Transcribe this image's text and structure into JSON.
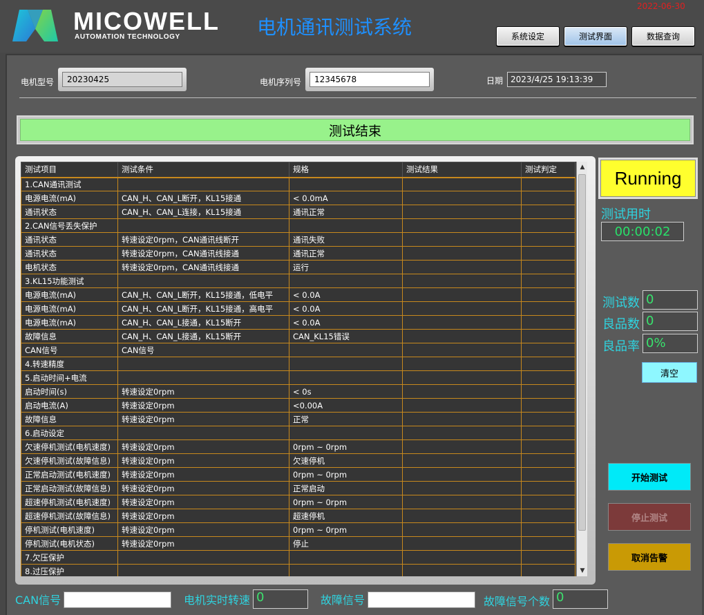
{
  "header": {
    "logo_text": "MICOWELL",
    "logo_sub": "AUTOMATION TECHNOLOGY",
    "title": "电机通讯测试系统",
    "corner_date": "2022-06-30",
    "nav": [
      "系统设定",
      "测试界面",
      "数据查询"
    ],
    "active_nav": 1
  },
  "info": {
    "model_label": "电机型号",
    "model_value": "20230425",
    "serial_label": "电机序列号",
    "serial_value": "12345678",
    "date_label": "日期",
    "date_value": "2023/4/25 19:13:39"
  },
  "status_text": "测试结束",
  "table": {
    "headers": [
      "测试项目",
      "测试条件",
      "规格",
      "测试结果",
      "测试判定"
    ],
    "rows": [
      [
        "1.CAN通讯测试",
        "",
        "",
        "",
        ""
      ],
      [
        "电源电流(mA)",
        "CAN_H、CAN_L断开，KL15接通",
        " < 0.0mA",
        "",
        ""
      ],
      [
        "通讯状态",
        "CAN_H、CAN_L连接，KL15接通",
        "通讯正常",
        "",
        ""
      ],
      [
        "2.CAN信号丢失保护",
        "",
        "",
        "",
        ""
      ],
      [
        "通讯状态",
        "转速设定0rpm，CAN通讯线断开",
        "通讯失败",
        "",
        ""
      ],
      [
        "通讯状态",
        "转速设定0rpm，CAN通讯线接通",
        "通讯正常",
        "",
        ""
      ],
      [
        "电机状态",
        "转速设定0rpm，CAN通讯线接通",
        "运行",
        "",
        ""
      ],
      [
        "3.KL15功能测试",
        "",
        "",
        "",
        ""
      ],
      [
        "电源电流(mA)",
        "CAN_H、CAN_L断开，KL15接通，低电平",
        " < 0.0A",
        "",
        ""
      ],
      [
        "电源电流(mA)",
        "CAN_H、CAN_L断开，KL15接通，高电平",
        " < 0.0A",
        "",
        ""
      ],
      [
        "电源电流(mA)",
        "CAN_H、CAN_L接通，KL15断开",
        " < 0.0A",
        "",
        ""
      ],
      [
        "故障信息",
        "CAN_H、CAN_L接通，KL15断开",
        "CAN_KL15错误",
        "",
        ""
      ],
      [
        "CAN信号",
        "CAN信号",
        "",
        "",
        ""
      ],
      [
        "4.转速精度",
        "",
        "",
        "",
        ""
      ],
      [
        "5.启动时间+电流",
        "",
        "",
        "",
        ""
      ],
      [
        "启动时间(s)",
        "转速设定0rpm",
        " < 0s",
        "",
        ""
      ],
      [
        "启动电流(A)",
        "转速设定0rpm",
        " <0.00A",
        "",
        ""
      ],
      [
        "故障信息",
        "转速设定0rpm",
        "正常",
        "",
        ""
      ],
      [
        "6.启动设定",
        "",
        "",
        "",
        ""
      ],
      [
        "欠速停机测试(电机速度)",
        "转速设定0rpm",
        " 0rpm ~ 0rpm",
        "",
        ""
      ],
      [
        "欠速停机测试(故障信息)",
        "转速设定0rpm",
        "欠速停机",
        "",
        ""
      ],
      [
        "正常启动测试(电机速度)",
        "转速设定0rpm",
        " 0rpm ~ 0rpm",
        "",
        ""
      ],
      [
        "正常启动测试(故障信息)",
        "转速设定0rpm",
        "正常启动",
        "",
        ""
      ],
      [
        "超速停机测试(电机速度)",
        "转速设定0rpm",
        " 0rpm ~ 0rpm",
        "",
        ""
      ],
      [
        "超速停机测试(故障信息)",
        "转速设定0rpm",
        "超速停机",
        "",
        ""
      ],
      [
        "停机测试(电机速度)",
        "转速设定0rpm",
        " 0rpm ~ 0rpm",
        "",
        ""
      ],
      [
        "停机测试(电机状态)",
        "转速设定0rpm",
        "停止",
        "",
        ""
      ],
      [
        "7.欠压保护",
        "",
        "",
        "",
        ""
      ],
      [
        "8.过压保护",
        "",
        "",
        "",
        ""
      ]
    ]
  },
  "right": {
    "running": "Running",
    "elapsed_label": "测试用时",
    "elapsed_value": "00:00:02",
    "count_label": "测试数",
    "count_value": "0",
    "good_label": "良品数",
    "good_value": "0",
    "rate_label": "良品率",
    "rate_value": "0%",
    "clear": "清空",
    "start": "开始测试",
    "stop": "停止测试",
    "cancel_alarm": "取消告警"
  },
  "bottom": {
    "can_label": "CAN信号",
    "can_value": "",
    "speed_label": "电机实时转速",
    "speed_value": "0",
    "fault_label": "故障信号",
    "fault_value": "",
    "fault_count_label": "故障信号个数",
    "fault_count_value": "0"
  },
  "colors": {
    "title_blue": "#1e90ff",
    "status_green": "#98f28b",
    "running_yellow": "#ffff2e",
    "label_cyan": "#2fd3df",
    "value_green": "#39e36e",
    "grid_orange": "#c8891d"
  }
}
